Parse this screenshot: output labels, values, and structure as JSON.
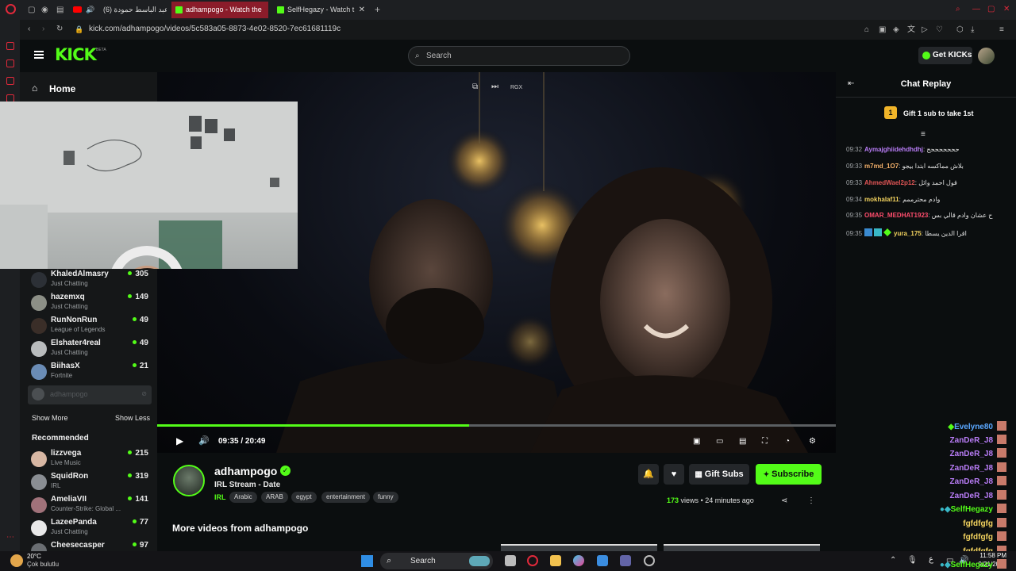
{
  "browser": {
    "tabs": [
      {
        "label": "عبد الباسط حمودة (6)",
        "active": false
      },
      {
        "label": "adhampogo - Watch the",
        "active": true
      },
      {
        "label": "SelfHegazy - Watch t",
        "active": false
      }
    ],
    "url": "kick.com/adhampogo/videos/5c583a05-8873-4e02-8520-7ec61681119c"
  },
  "header": {
    "logo": "KICK",
    "logo_badge": "BETA",
    "search_placeholder": "Search",
    "get_kicks": "Get KICKs"
  },
  "sidebar": {
    "home": "Home",
    "following": [
      {
        "name": "KhaledAlmasry",
        "category": "Just Chatting",
        "viewers": "305"
      },
      {
        "name": "hazemxq",
        "category": "Just Chatting",
        "viewers": "149"
      },
      {
        "name": "RunNonRun",
        "category": "League of Legends",
        "viewers": "49"
      },
      {
        "name": "Elshater4real",
        "category": "Just Chatting",
        "viewers": "49"
      },
      {
        "name": "BiihasX",
        "category": "Fortnite",
        "viewers": "21"
      }
    ],
    "offline_channel": "adhampogo",
    "show_more": "Show More",
    "show_less": "Show Less",
    "recommended_heading": "Recommended",
    "recommended": [
      {
        "name": "lizzvega",
        "category": "Live Music",
        "viewers": "215"
      },
      {
        "name": "SquidRon",
        "category": "IRL",
        "viewers": "319"
      },
      {
        "name": "AmeliaVII",
        "category": "Counter-Strike: Global ...",
        "viewers": "141"
      },
      {
        "name": "LazeePanda",
        "category": "Just Chatting",
        "viewers": "77"
      },
      {
        "name": "Cheesecasper",
        "category": "",
        "viewers": "97"
      }
    ]
  },
  "player": {
    "current_time": "09:35",
    "duration": "20:49",
    "progress": 0.46,
    "top_badge": "RGX"
  },
  "video_info": {
    "channel": "adhampogo",
    "title": "IRL Stream - Date",
    "category": "IRL",
    "tags": [
      "Arabic",
      "ARAB",
      "egypt",
      "entertainment",
      "funny"
    ],
    "views_count": "173",
    "views_label": "views",
    "age": "24 minutes ago",
    "gift_subs": "Gift Subs",
    "subscribe": "Subscribe",
    "more_videos": "More videos from adhampogo"
  },
  "chat": {
    "title": "Chat Replay",
    "pinned_rank": "1",
    "pinned_text": "Gift 1 sub to take 1st",
    "messages": [
      {
        "time": "09:32",
        "user": "Aymajghiidehdhdhj",
        "color": "#b97df7",
        "text": "حححححححح"
      },
      {
        "time": "09:33",
        "user": "m7md_1O7",
        "color": "#f6b26b",
        "text": "بلاش مماكسه ابتدا بيجو"
      },
      {
        "time": "09:33",
        "user": "AhmedWael2p12",
        "color": "#e05555",
        "text": "قول احمد وائل"
      },
      {
        "time": "09:34",
        "user": "mokhalaf11",
        "color": "#f3d35f",
        "text": "وادم محترممم"
      },
      {
        "time": "09:35",
        "user": "OMAR_MEDHAT1923",
        "color": "#ff4d6d",
        "text": "ح عشان وادم قالي بس"
      },
      {
        "time": "09:35",
        "user": "yura_175",
        "color": "#f3d35f",
        "text": "اقرا الدين يسطا"
      }
    ],
    "overlay_names": [
      {
        "name": "Evelyne80",
        "color": "#5aa7ff"
      },
      {
        "name": "ZanDeR_J8",
        "color": "#b97df7"
      },
      {
        "name": "ZanDeR_J8",
        "color": "#b97df7"
      },
      {
        "name": "ZanDeR_J8",
        "color": "#b97df7"
      },
      {
        "name": "ZanDeR_J8",
        "color": "#b97df7"
      },
      {
        "name": "ZanDeR_J8",
        "color": "#b97df7"
      },
      {
        "name": "SelfHegazy",
        "color": "#53fc18"
      },
      {
        "name": "fgfdfgfg",
        "color": "#f3d35f"
      },
      {
        "name": "fgfdfgfg",
        "color": "#f3d35f"
      },
      {
        "name": "fgfdfgfg",
        "color": "#f3d35f"
      },
      {
        "name": "SelfHegazy",
        "color": "#53fc18"
      }
    ]
  },
  "taskbar": {
    "weather_temp": "20°C",
    "weather_desc": "Çok bulutlu",
    "search": "Search",
    "lang": "ع",
    "time": "11:58 PM",
    "date": "9/21/2025"
  },
  "colors": {
    "accent": "#53fc18",
    "tab_active": "#8b1c2a"
  }
}
